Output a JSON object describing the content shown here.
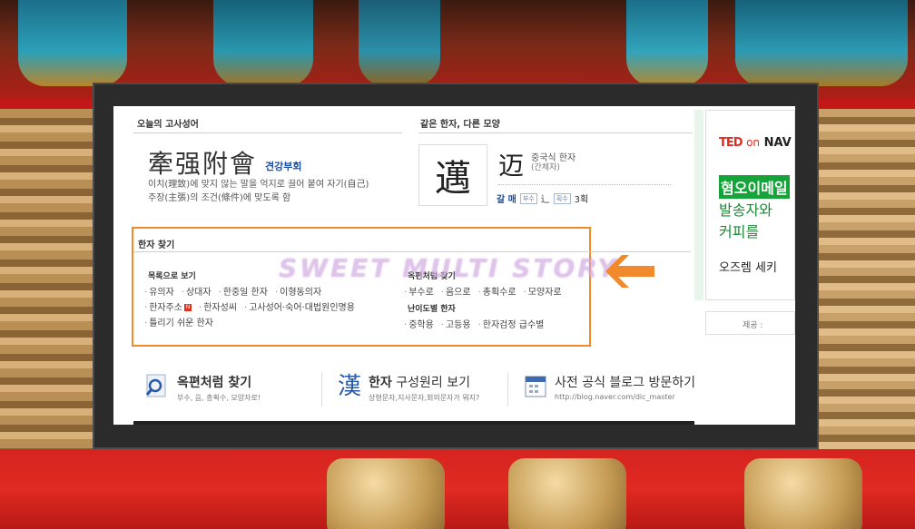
{
  "idiom_section": {
    "title": "오늘의 고사성어",
    "chars": "牽强附會",
    "reading": "견강부회",
    "desc_line1": "이치(理致)에 맞지 않는 말을 억지로 끌어 붙여 자기(自己)",
    "desc_line2": "주장(主張)의 조건(條件)에 맞도록 함"
  },
  "same_hanja_section": {
    "title": "같은 한자, 다른 모양",
    "main_char": "邁",
    "alt_char": "迈",
    "alt_type": "중국식 한자",
    "alt_sub": "(간체자)",
    "reading": "갈 매",
    "tag_bushu": "부수",
    "radical": "辶",
    "tag_strokes": "획수",
    "strokes": "3획"
  },
  "search_section": {
    "title": "한자 찾기",
    "list_view": {
      "heading": "목록으로 보기",
      "row1": [
        "유의자",
        "상대자",
        "한중일 한자",
        "이형동의자"
      ],
      "row2": [
        "한자주소",
        "한자성씨",
        "고사성어·숙어·대법원인명용"
      ],
      "row3": [
        "틀리기 쉬운 한자"
      ],
      "new_badge": "N"
    },
    "okpyeon": {
      "heading": "옥편처럼 찾기",
      "links": [
        "부수로",
        "음으로",
        "총획수로",
        "모양자로"
      ]
    },
    "difficulty": {
      "heading": "난이도별 한자",
      "links": [
        "중학용",
        "고등용",
        "한자검정 급수별"
      ]
    }
  },
  "watermark": "SWEET MULTI STORY",
  "bottom_links": [
    {
      "title_bold": "옥편처럼 찾기",
      "title_rest": "",
      "sub": "부수, 음, 총획수, 모양자로!"
    },
    {
      "icon_char": "漢",
      "title_bold": "한자",
      "title_rest": " 구성원리 보기",
      "sub": "상형문자,지사문자,회의문자가 뭐지?"
    },
    {
      "title_bold": "",
      "title_rest": "사전 공식 블로그 방문하기",
      "sub": "http://blog.naver.com/dic_master"
    }
  ],
  "ad": {
    "ted": "TED",
    "on": "on",
    "nav": "NAV",
    "green_text": "혐오이메일",
    "line1": "발송자와",
    "line2": "커피를",
    "cta": "오즈렘 세키",
    "provider": "제공 :"
  },
  "colors": {
    "orange_highlight": "#f08a2c",
    "link_blue": "#1a4ea8",
    "ted_red": "#e62b1e",
    "ad_green": "#15a33a"
  }
}
